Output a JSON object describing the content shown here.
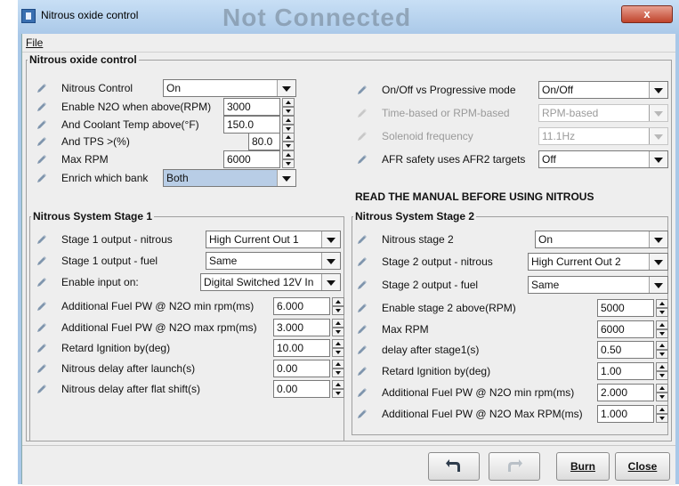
{
  "window": {
    "title": "Nitrous oxide control",
    "ghost_title": "Not Connected",
    "close_glyph": "x"
  },
  "menu": {
    "file": "File"
  },
  "main_group": {
    "title": "Nitrous oxide control"
  },
  "left_fields": [
    {
      "label": "Nitrous Control",
      "kind": "combo",
      "value": "On"
    },
    {
      "label": "Enable N2O when above(RPM)",
      "kind": "spin",
      "value": "3000"
    },
    {
      "label": "And Coolant Temp above(°F)",
      "kind": "spin",
      "value": "150.0"
    },
    {
      "label": "And TPS >(%)",
      "kind": "spin",
      "value": "80.0"
    },
    {
      "label": "Max RPM",
      "kind": "spin",
      "value": "6000"
    },
    {
      "label": "Enrich which bank",
      "kind": "combo",
      "value": "Both"
    }
  ],
  "right_fields": [
    {
      "label": "On/Off vs Progressive mode",
      "kind": "combo",
      "value": "On/Off",
      "enabled": true
    },
    {
      "label": "Time-based or RPM-based",
      "kind": "combo",
      "value": "RPM-based",
      "enabled": false
    },
    {
      "label": "Solenoid frequency",
      "kind": "combo",
      "value": "11.1Hz",
      "enabled": false
    },
    {
      "label": "AFR safety uses AFR2 targets",
      "kind": "combo",
      "value": "Off",
      "enabled": true
    }
  ],
  "warning": "READ THE MANUAL BEFORE USING NITROUS",
  "stage1": {
    "title": "Nitrous System Stage 1",
    "fields": [
      {
        "label": "Stage 1 output - nitrous",
        "kind": "combo",
        "value": "High Current Out 1"
      },
      {
        "label": "Stage 1 output - fuel",
        "kind": "combo",
        "value": "Same"
      },
      {
        "label": "Enable input on:",
        "kind": "combo",
        "value": "Digital Switched 12V In"
      },
      {
        "label": "Additional Fuel PW @ N2O min rpm(ms)",
        "kind": "spin",
        "value": "6.000"
      },
      {
        "label": "Additional Fuel PW @ N2O max rpm(ms)",
        "kind": "spin",
        "value": "3.000"
      },
      {
        "label": "Retard Ignition by(deg)",
        "kind": "spin",
        "value": "10.00"
      },
      {
        "label": "Nitrous delay after launch(s)",
        "kind": "spin",
        "value": "0.00"
      },
      {
        "label": "Nitrous delay after flat shift(s)",
        "kind": "spin",
        "value": "0.00"
      }
    ]
  },
  "stage2": {
    "title": "Nitrous System Stage 2",
    "fields": [
      {
        "label": "Nitrous stage 2",
        "kind": "combo",
        "value": "On"
      },
      {
        "label": "Stage 2 output - nitrous",
        "kind": "combo",
        "value": "High Current Out 2"
      },
      {
        "label": "Stage 2 output - fuel",
        "kind": "combo",
        "value": "Same"
      },
      {
        "label": "Enable stage 2 above(RPM)",
        "kind": "spin",
        "value": "5000"
      },
      {
        "label": "Max RPM",
        "kind": "spin",
        "value": "6000"
      },
      {
        "label": "delay after stage1(s)",
        "kind": "spin",
        "value": "0.50"
      },
      {
        "label": "Retard Ignition by(deg)",
        "kind": "spin",
        "value": "1.00"
      },
      {
        "label": "Additional Fuel PW @ N2O min rpm(ms)",
        "kind": "spin",
        "value": "2.000"
      },
      {
        "label": "Additional Fuel PW @ N2O Max RPM(ms)",
        "kind": "spin",
        "value": "1.000"
      }
    ]
  },
  "footer": {
    "undo_icon": "undo-icon",
    "redo_icon": "redo-icon",
    "burn": "Burn",
    "close": "Close"
  },
  "colors": {
    "title_bar": "#a9c8e8",
    "panel": "#eeeeee",
    "selected_combo": "#b8cde6"
  }
}
